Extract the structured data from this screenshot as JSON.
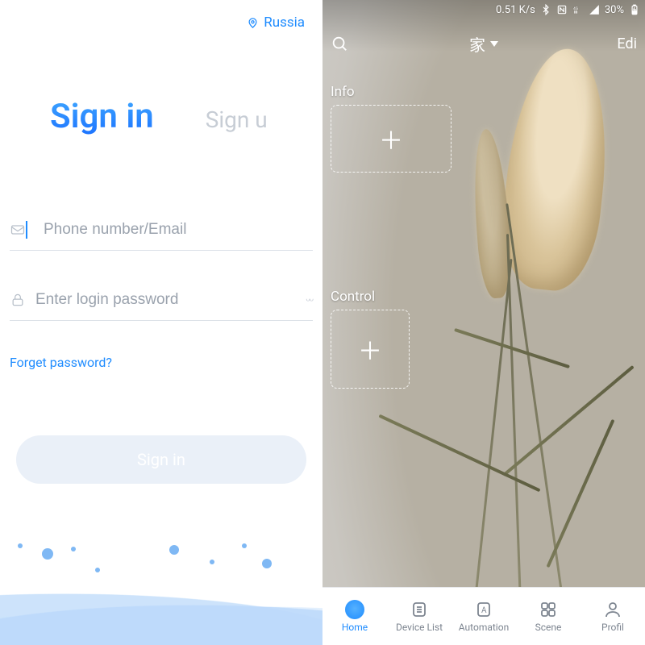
{
  "left": {
    "region": "Russia",
    "tabs": {
      "signin": "Sign in",
      "signup": "Sign u"
    },
    "fields": {
      "username_placeholder": "Phone number/Email",
      "password_placeholder": "Enter login password"
    },
    "forgot": "Forget password?",
    "button": "Sign in"
  },
  "right": {
    "status": {
      "speed": "0.51 K/s",
      "battery": "30%"
    },
    "appbar": {
      "title": "家",
      "edit": "Edi"
    },
    "sections": {
      "info": "Info",
      "control": "Control"
    },
    "nav": {
      "home": "Home",
      "device_list": "Device List",
      "automation": "Automation",
      "scene": "Scene",
      "profile": "Profil"
    }
  }
}
